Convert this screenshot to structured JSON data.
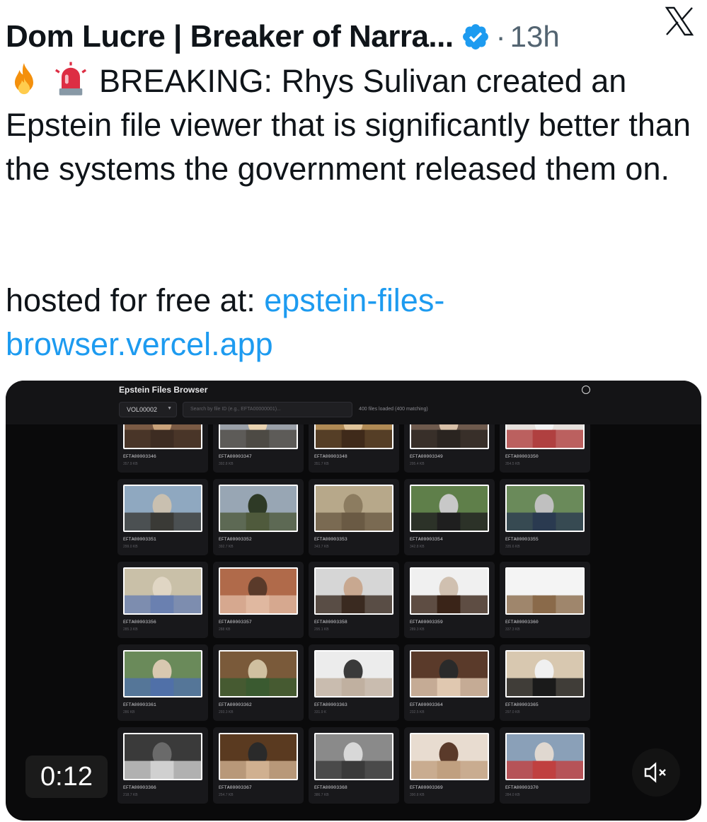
{
  "tweet": {
    "author": "Dom Lucre | Breaker of Narra...",
    "separator": "·",
    "time": "13h",
    "emoji": [
      "fire-emoji",
      "rotating-light-emoji"
    ],
    "body_line1": "BREAKING: Rhys Sulivan created an Epstein file viewer that is significantly better than the systems the government released them on.",
    "hosted_prefix": "hosted for free at: ",
    "link_text": "epstein-files-browser.vercel.app",
    "link_color": "#1d9bf0"
  },
  "video": {
    "timer": "0:12",
    "app": {
      "title": "Epstein Files Browser",
      "volume": "VOL00002",
      "search_placeholder": "Search by file ID (e.g., EFTA00000001)...",
      "status": "400 files loaded (400 matching)"
    },
    "files": [
      {
        "id": "EFTA00003346",
        "size": "357.9 KB"
      },
      {
        "id": "EFTA00003347",
        "size": "392.8 KB"
      },
      {
        "id": "EFTA00003348",
        "size": "351.7 KB"
      },
      {
        "id": "EFTA00003349",
        "size": "295.4 KB"
      },
      {
        "id": "EFTA00003350",
        "size": "354.5 KB"
      },
      {
        "id": "EFTA00003351",
        "size": "299.0 KB"
      },
      {
        "id": "EFTA00003352",
        "size": "392.7 KB"
      },
      {
        "id": "EFTA00003353",
        "size": "343.7 KB"
      },
      {
        "id": "EFTA00003354",
        "size": "342.8 KB"
      },
      {
        "id": "EFTA00003355",
        "size": "335.6 KB"
      },
      {
        "id": "EFTA00003356",
        "size": "285.3 KB"
      },
      {
        "id": "EFTA00003357",
        "size": "288 KB"
      },
      {
        "id": "EFTA00003358",
        "size": "295.1 KB"
      },
      {
        "id": "EFTA00003359",
        "size": "289.3 KB"
      },
      {
        "id": "EFTA00003360",
        "size": "337.3 KB"
      },
      {
        "id": "EFTA00003361",
        "size": "286 KB"
      },
      {
        "id": "EFTA00003362",
        "size": "293.3 KB"
      },
      {
        "id": "EFTA00003363",
        "size": "331.9 K"
      },
      {
        "id": "EFTA00003364",
        "size": "232.5 KB"
      },
      {
        "id": "EFTA00003365",
        "size": "297.0 KB"
      },
      {
        "id": "EFTA00003366",
        "size": "218.7 KB"
      },
      {
        "id": "EFTA00003367",
        "size": "254.7 KB"
      },
      {
        "id": "EFTA00003368",
        "size": "386.7 KB"
      },
      {
        "id": "EFTA00003369",
        "size": "390.8 KB"
      },
      {
        "id": "EFTA00003370",
        "size": "284.0 KB"
      }
    ]
  }
}
